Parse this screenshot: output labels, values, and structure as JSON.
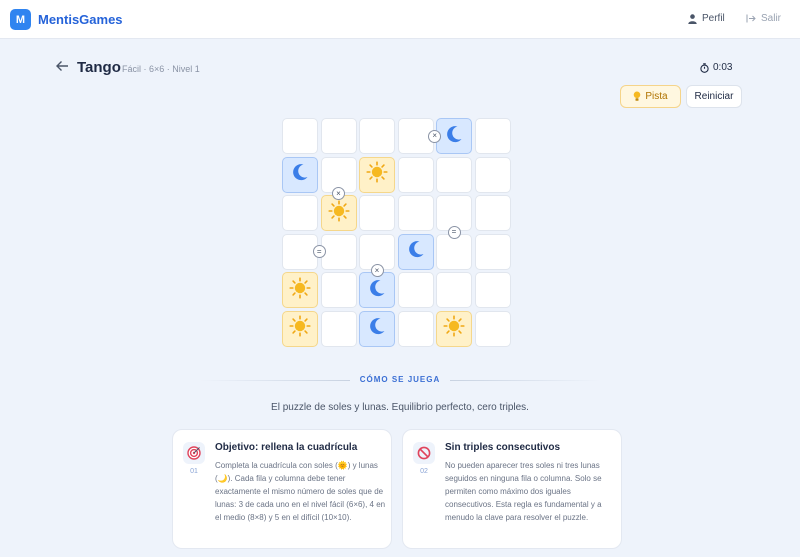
{
  "header": {
    "logo_letter": "M",
    "brand": "MentisGames",
    "profile_label": "Perfil",
    "logout_label": "Salir"
  },
  "game": {
    "back_icon": "arrow-left-icon",
    "title": "Tango",
    "subtitle": "Fácil · 6×6 · Nivel 1",
    "timer": "0:03",
    "hint_label": "Pista",
    "reset_label": "Reiniciar"
  },
  "board": {
    "size": 6,
    "cells": [
      [
        "",
        "",
        "",
        "",
        "moon",
        ""
      ],
      [
        "moon",
        "",
        "sun",
        "",
        "",
        ""
      ],
      [
        "",
        "sun",
        "",
        "",
        "",
        ""
      ],
      [
        "",
        "",
        "",
        "moon",
        "",
        ""
      ],
      [
        "sun",
        "",
        "moon",
        "",
        "",
        ""
      ],
      [
        "sun",
        "",
        "moon",
        "",
        "sun",
        ""
      ]
    ],
    "constraints": [
      {
        "symbol": "×",
        "between": [
          [
            0,
            3
          ],
          [
            0,
            4
          ]
        ]
      },
      {
        "symbol": "×",
        "between": [
          [
            1,
            1
          ],
          [
            2,
            1
          ]
        ]
      },
      {
        "symbol": "=",
        "between": [
          [
            2,
            4
          ],
          [
            3,
            4
          ]
        ]
      },
      {
        "symbol": "=",
        "between": [
          [
            3,
            0
          ],
          [
            3,
            1
          ]
        ]
      },
      {
        "symbol": "×",
        "between": [
          [
            3,
            2
          ],
          [
            4,
            2
          ]
        ]
      }
    ]
  },
  "how_to": {
    "heading": "CÓMO SE JUEGA",
    "tagline": "El puzzle de soles y lunas. Equilibrio perfecto, cero triples.",
    "cards": [
      {
        "icon": "target-icon",
        "number": "01",
        "title": "Objetivo: rellena la cuadrícula",
        "text": "Completa la cuadrícula con soles (🌞) y lunas (🌙). Cada fila y columna debe tener exactamente el mismo número de soles que de lunas: 3 de cada uno en el nivel fácil (6×6), 4 en el medio (8×8) y 5 en el difícil (10×10)."
      },
      {
        "icon": "no-entry-icon",
        "number": "02",
        "title": "Sin triples consecutivos",
        "text": "No pueden aparecer tres soles ni tres lunas seguidos en ninguna fila o columna. Solo se permiten como máximo dos iguales consecutivos. Esta regla es fundamental y a menudo la clave para resolver el puzzle."
      }
    ]
  },
  "colors": {
    "accent": "#2f84f0",
    "sun_cell": "#fff1c8",
    "moon_cell": "#d8e8ff",
    "moon_icon": "#3b7ee8",
    "sun_icon": "#f6b921"
  }
}
